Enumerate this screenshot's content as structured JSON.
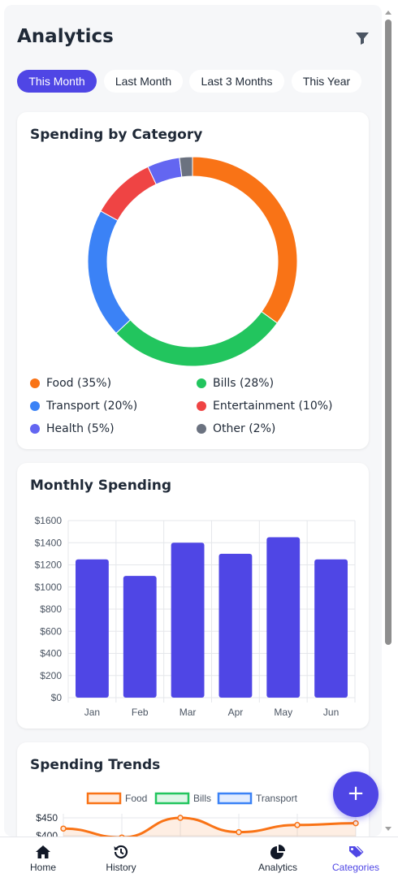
{
  "header": {
    "title": "Analytics",
    "filter_icon": "filter-icon"
  },
  "tabs": [
    {
      "label": "This Month",
      "active": true
    },
    {
      "label": "Last Month",
      "active": false
    },
    {
      "label": "Last 3 Months",
      "active": false
    },
    {
      "label": "This Year",
      "active": false
    }
  ],
  "category_card": {
    "title": "Spending by Category",
    "legend": [
      {
        "label": "Food (35%)",
        "color": "#f97316"
      },
      {
        "label": "Bills (28%)",
        "color": "#22c55e"
      },
      {
        "label": "Transport (20%)",
        "color": "#3b82f6"
      },
      {
        "label": "Entertainment (10%)",
        "color": "#ef4444"
      },
      {
        "label": "Health (5%)",
        "color": "#6366f1"
      },
      {
        "label": "Other (2%)",
        "color": "#6b7280"
      }
    ]
  },
  "monthly_card": {
    "title": "Monthly Spending"
  },
  "trends_card": {
    "title": "Spending Trends"
  },
  "fab": {
    "label": "+"
  },
  "bottom_nav": [
    {
      "label": "Home",
      "icon": "home-icon",
      "active": false
    },
    {
      "label": "History",
      "icon": "history-icon",
      "active": false
    },
    {
      "label": "Analytics",
      "icon": "pie-chart-icon",
      "active": false
    },
    {
      "label": "Categories",
      "icon": "tags-icon",
      "active": true
    }
  ],
  "chart_data": [
    {
      "type": "pie",
      "title": "Spending by Category",
      "categories": [
        "Food",
        "Bills",
        "Transport",
        "Entertainment",
        "Health",
        "Other"
      ],
      "values": [
        35,
        28,
        20,
        10,
        5,
        2
      ],
      "colors": [
        "#f97316",
        "#22c55e",
        "#3b82f6",
        "#ef4444",
        "#6366f1",
        "#6b7280"
      ],
      "donut": true
    },
    {
      "type": "bar",
      "title": "Monthly Spending",
      "categories": [
        "Jan",
        "Feb",
        "Mar",
        "Apr",
        "May",
        "Jun"
      ],
      "values": [
        1250,
        1100,
        1400,
        1300,
        1450,
        1250
      ],
      "ylim": [
        0,
        1600
      ],
      "yticks": [
        "$0",
        "$200",
        "$400",
        "$600",
        "$800",
        "$1000",
        "$1200",
        "$1400",
        "$1600"
      ],
      "color": "#4f46e5",
      "grid": true
    },
    {
      "type": "line",
      "title": "Spending Trends",
      "legend": [
        {
          "name": "Food",
          "color": "#f97316"
        },
        {
          "name": "Bills",
          "color": "#22c55e"
        },
        {
          "name": "Transport",
          "color": "#3b82f6"
        }
      ],
      "yticks_visible": [
        "$450",
        "$400"
      ],
      "series": [
        {
          "name": "Food",
          "values": [
            420,
            395,
            450,
            410,
            430,
            435
          ]
        }
      ]
    }
  ]
}
